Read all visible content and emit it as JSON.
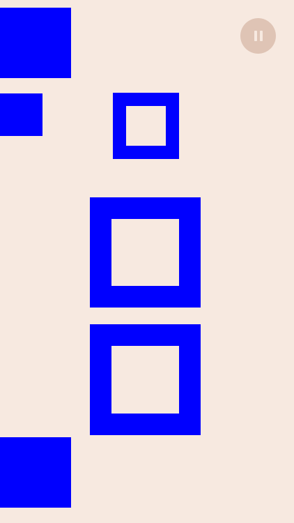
{
  "game": {
    "background_color": "#f7e9e0",
    "block_color": "#0000ff",
    "tiles": [
      {
        "kind": "filled-square"
      },
      {
        "kind": "filled-square"
      },
      {
        "kind": "hollow-square"
      },
      {
        "kind": "hollow-square"
      },
      {
        "kind": "hollow-square"
      },
      {
        "kind": "filled-square"
      }
    ]
  },
  "controls": {
    "pause_button_color": "#dfc4b5",
    "pause_icon": "pause-icon"
  }
}
